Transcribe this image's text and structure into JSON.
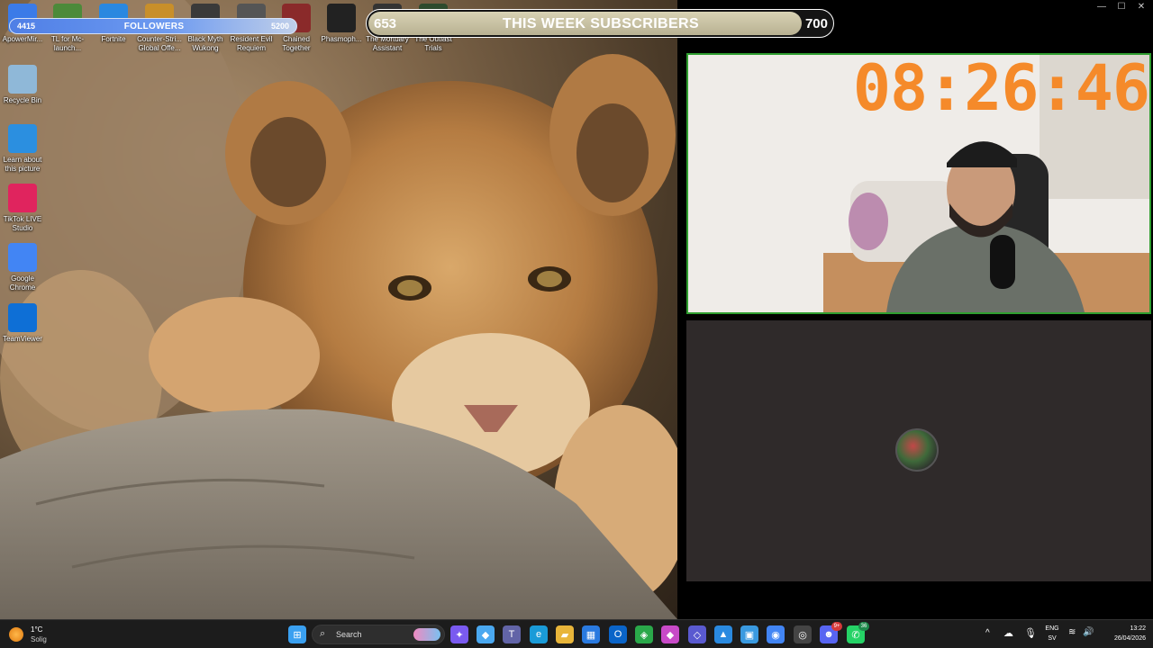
{
  "desktop": {
    "top_icons": [
      {
        "label": "ApowerMir...",
        "icon": "apowermirror-icon",
        "color": "#3b7be8"
      },
      {
        "label": "TL for Mc-launch...",
        "icon": "minecraft-launcher-icon",
        "color": "#4c8a3a"
      },
      {
        "label": "Fortnite",
        "icon": "fortnite-icon",
        "color": "#2a88e0"
      },
      {
        "label": "Counter-Stri... Global Offe...",
        "icon": "counter-strike-icon",
        "color": "#c88f2a"
      },
      {
        "label": "Black Myth Wukong",
        "icon": "black-myth-wukong-icon",
        "color": "#3a3a3a"
      },
      {
        "label": "Resident Evil Requiem",
        "icon": "resident-evil-icon",
        "color": "#555"
      },
      {
        "label": "Chained Together",
        "icon": "chained-together-icon",
        "color": "#8a2a2a"
      },
      {
        "label": "Phasmoph...",
        "icon": "phasmophobia-icon",
        "color": "#222"
      },
      {
        "label": "The Mortuary Assistant",
        "icon": "mortuary-assistant-icon",
        "color": "#333"
      },
      {
        "label": "The Outlast Trials",
        "icon": "outlast-trials-icon",
        "color": "#2d4a2d"
      }
    ],
    "side_icons": [
      {
        "label": "Recycle Bin",
        "icon": "recycle-bin-icon",
        "color": "#8fb8d8"
      },
      {
        "label": "Learn about this picture",
        "icon": "learn-about-picture-icon",
        "color": "#2b8fe0"
      },
      {
        "label": "TikTok LIVE Studio",
        "icon": "tiktok-live-studio-icon",
        "color": "#e0245e"
      },
      {
        "label": "Google Chrome",
        "icon": "chrome-icon",
        "color": "#4285f4"
      },
      {
        "label": "TeamViewer",
        "icon": "teamviewer-icon",
        "color": "#0e6fd6"
      }
    ]
  },
  "followers_bar": {
    "current": "4415",
    "label": "FOLLOWERS",
    "goal": "5200",
    "progress": 0.849
  },
  "subscribers_bar": {
    "current": "653",
    "label": "THIS WEEK SUBSCRIBERS",
    "goal": "700",
    "progress": 0.933
  },
  "window_controls": {
    "minimize": "—",
    "maximize": "☐",
    "close": "✕"
  },
  "webcam": {
    "timer": "08:26:46",
    "timer_color": "#f58a2a",
    "border_color": "#2f9e2f"
  },
  "taskbar": {
    "weather": {
      "temp": "1°C",
      "condition": "Solig"
    },
    "search_label": "Search",
    "apps": [
      {
        "name": "start-button",
        "glyph": "⊞",
        "color": "#3aa0f0"
      },
      {
        "name": "copilot-app",
        "glyph": "✦",
        "color": "#7a5af0"
      },
      {
        "name": "file-app",
        "glyph": "▤",
        "color": "#777"
      },
      {
        "name": "copilot-icon",
        "glyph": "◆",
        "color": "#4aa8f0"
      },
      {
        "name": "teams-icon",
        "glyph": "T",
        "color": "#6264a7"
      },
      {
        "name": "edge-icon",
        "glyph": "e",
        "color": "#1a9bd8"
      },
      {
        "name": "file-explorer-icon",
        "glyph": "▰",
        "color": "#e8b53a"
      },
      {
        "name": "store-icon",
        "glyph": "▦",
        "color": "#2a7ae0"
      },
      {
        "name": "outlook-icon",
        "glyph": "O",
        "color": "#0a64c8"
      },
      {
        "name": "vpn-icon",
        "glyph": "◈",
        "color": "#2aa84a"
      },
      {
        "name": "mixed-app-icon",
        "glyph": "◆",
        "color": "#c84ac8"
      },
      {
        "name": "dev-app-icon",
        "glyph": "◇",
        "color": "#5a5ad0"
      },
      {
        "name": "photos-icon",
        "glyph": "▲",
        "color": "#2a8ae0"
      },
      {
        "name": "screen-app-icon",
        "glyph": "▣",
        "color": "#3a9ae0"
      },
      {
        "name": "chrome-taskbar-icon",
        "glyph": "◉",
        "color": "#4285f4"
      },
      {
        "name": "obs-icon",
        "glyph": "◎",
        "color": "#444"
      },
      {
        "name": "discord-icon",
        "glyph": "☻",
        "color": "#5865f2",
        "badge": "9+"
      },
      {
        "name": "whatsapp-icon",
        "glyph": "✆",
        "color": "#25d366",
        "badge": "36"
      }
    ],
    "tray": {
      "lang": "ENG",
      "region": "SV",
      "time": "13:22",
      "date": "26/04/2026"
    }
  }
}
